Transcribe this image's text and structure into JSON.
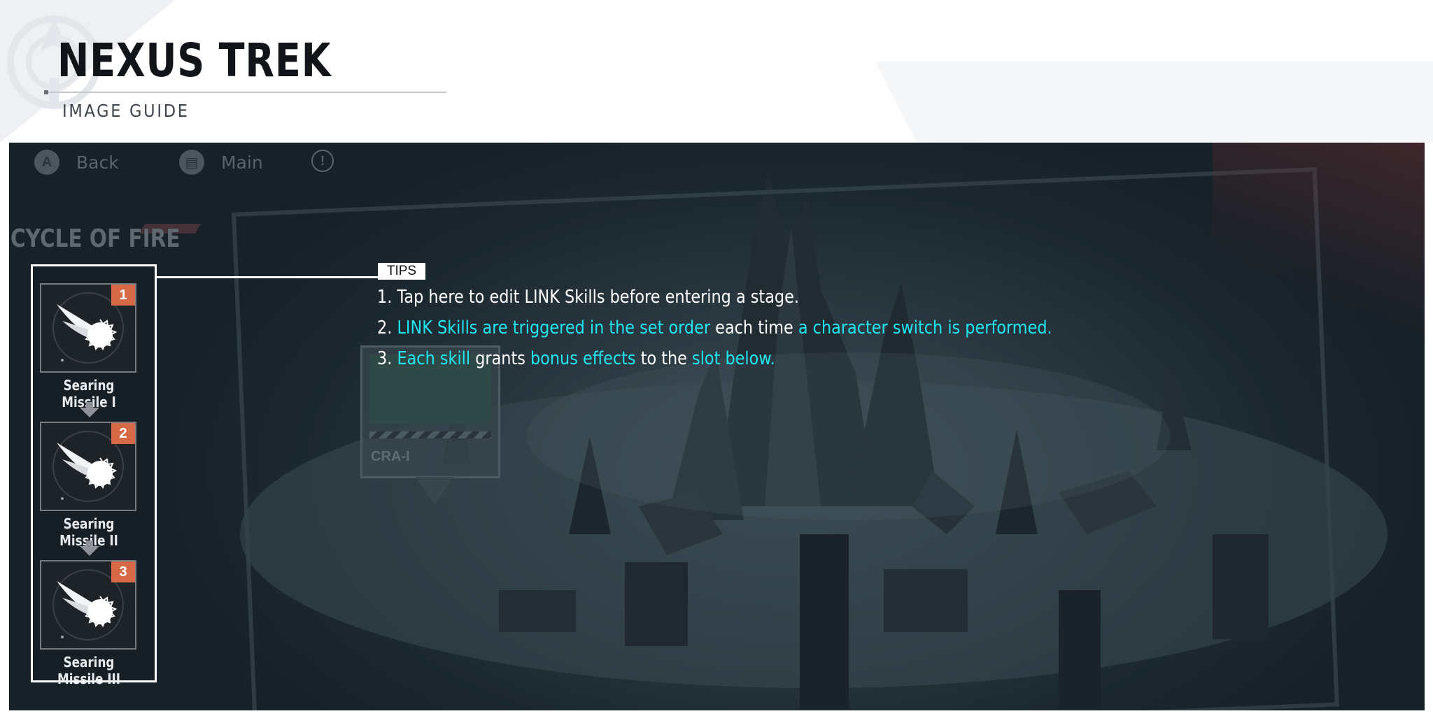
{
  "header": {
    "title": "NEXUS TREK",
    "subtitle": "IMAGE GUIDE"
  },
  "game": {
    "nav": {
      "back_glyph": "A",
      "back_label": "Back",
      "main_glyph": "▤",
      "main_label": "Main",
      "info_glyph": "!"
    },
    "stage_title": "CYCLE OF FIRE",
    "map_node_label": "CRA-I",
    "tips": {
      "tag": "TIPS",
      "lines": [
        [
          {
            "text": "1. Tap here to edit LINK Skills before entering a stage.",
            "highlight": false
          }
        ],
        [
          {
            "text": "2. ",
            "highlight": false
          },
          {
            "text": "LINK Skills are triggered in the set order",
            "highlight": true
          },
          {
            "text": " each time ",
            "highlight": false
          },
          {
            "text": "a character switch is performed.",
            "highlight": true
          }
        ],
        [
          {
            "text": "3. ",
            "highlight": false
          },
          {
            "text": "Each skill",
            "highlight": true
          },
          {
            "text": " grants ",
            "highlight": false
          },
          {
            "text": "bonus effects",
            "highlight": true
          },
          {
            "text": " to the ",
            "highlight": false
          },
          {
            "text": "slot below.",
            "highlight": true
          }
        ]
      ]
    },
    "link_skills": [
      {
        "order": "1",
        "name": "Searing Missile I",
        "icon": "missile-icon"
      },
      {
        "order": "2",
        "name": "Searing Missile II",
        "icon": "missile-icon"
      },
      {
        "order": "3",
        "name": "Searing Missile III",
        "icon": "missile-icon"
      }
    ]
  },
  "colors": {
    "highlight": "#1fe6ee",
    "badge": "#d76a46",
    "panel_border": "#ffffff",
    "title": "#111418"
  }
}
